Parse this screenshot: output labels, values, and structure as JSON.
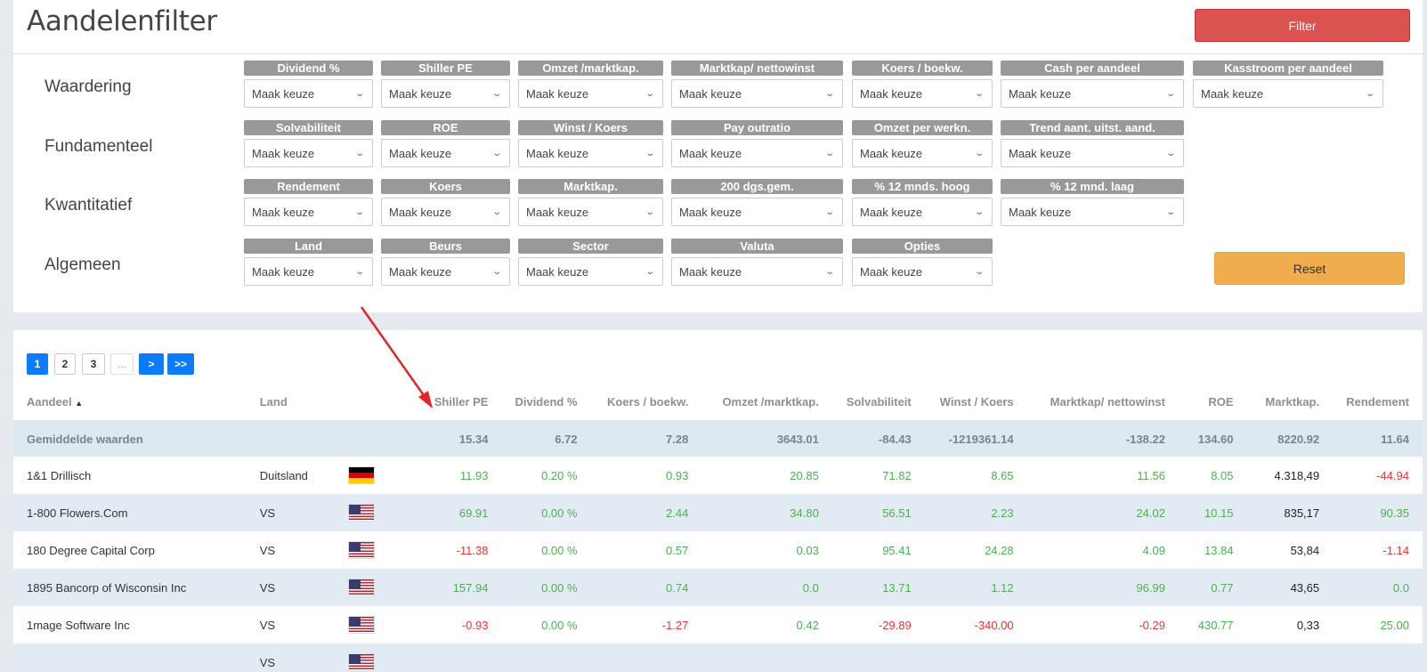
{
  "page": {
    "title": "Aandelenfilter",
    "filter_label": "Filter",
    "reset_label": "Reset"
  },
  "filters": {
    "placeholder": "Maak keuze",
    "rows": [
      {
        "label": "Waardering",
        "items": [
          "Dividend %",
          "Shiller PE",
          "Omzet /marktkap.",
          "Marktkap/ nettowinst",
          "Koers / boekw.",
          "Cash per aandeel",
          "Kasstroom per aandeel"
        ]
      },
      {
        "label": "Fundamenteel",
        "items": [
          "Solvabiliteit",
          "ROE",
          "Winst / Koers",
          "Pay outratio",
          "Omzet per werkn.",
          "Trend aant. uitst. aand."
        ]
      },
      {
        "label": "Kwantitatief",
        "items": [
          "Rendement",
          "Koers",
          "Marktkap.",
          "200 dgs.gem.",
          "% 12 mnds. hoog",
          "% 12 mnd. laag"
        ]
      },
      {
        "label": "Algemeen",
        "items": [
          "Land",
          "Beurs",
          "Sector",
          "Valuta",
          "Opties"
        ]
      }
    ]
  },
  "pagination": {
    "pages": [
      "1",
      "2",
      "3",
      "..."
    ],
    "next": ">",
    "last": ">>"
  },
  "table": {
    "columns": [
      "Aandeel",
      "Land",
      "",
      "Shiller PE",
      "Dividend %",
      "Koers / boekw.",
      "Omzet /marktkap.",
      "Solvabiliteit",
      "Winst / Koers",
      "Marktkap/ nettowinst",
      "ROE",
      "Marktkap.",
      "Rendement"
    ],
    "sort_indicator": "▲",
    "average": {
      "label": "Gemiddelde waarden",
      "values": [
        "15.34",
        "6.72",
        "7.28",
        "3643.01",
        "-84.43",
        "-1219361.14",
        "-138.22",
        "134.60",
        "8220.92",
        "11.64"
      ]
    },
    "rows": [
      {
        "name": "1&1 Drillisch",
        "land": "Duitsland",
        "flag": "de",
        "values": [
          "11.93",
          "0.20 %",
          "0.93",
          "20.85",
          "71.82",
          "8.65",
          "11.56",
          "8.05",
          "4.318,49",
          "-44.94"
        ]
      },
      {
        "name": "1-800 Flowers.Com",
        "land": "VS",
        "flag": "us",
        "values": [
          "69.91",
          "0.00 %",
          "2.44",
          "34.80",
          "56.51",
          "2.23",
          "24.02",
          "10.15",
          "835,17",
          "90.35"
        ]
      },
      {
        "name": "180 Degree Capital Corp",
        "land": "VS",
        "flag": "us",
        "values": [
          "-11.38",
          "0.00 %",
          "0.57",
          "0.03",
          "95.41",
          "24.28",
          "4.09",
          "13.84",
          "53,84",
          "-1.14"
        ]
      },
      {
        "name": "1895 Bancorp of Wisconsin Inc",
        "land": "VS",
        "flag": "us",
        "values": [
          "157.94",
          "0.00 %",
          "0.74",
          "0.0",
          "13.71",
          "1.12",
          "96.99",
          "0.77",
          "43,65",
          "0.0"
        ]
      },
      {
        "name": "1mage Software Inc",
        "land": "VS",
        "flag": "us",
        "values": [
          "-0.93",
          "0.00 %",
          "-1.27",
          "0.42",
          "-29.89",
          "-340.00",
          "-0.29",
          "430.77",
          "0,33",
          "25.00"
        ]
      },
      {
        "name": "",
        "land": "VS",
        "flag": "us",
        "values": [
          "",
          "",
          "",
          "",
          "",
          "",
          "",
          "",
          "",
          ""
        ]
      }
    ]
  },
  "colors": {
    "positive": "#4caf50",
    "negative": "#e53935",
    "filter_button": "#d9534f",
    "reset_button": "#f0ad4e",
    "active_page": "#0b7bff"
  }
}
